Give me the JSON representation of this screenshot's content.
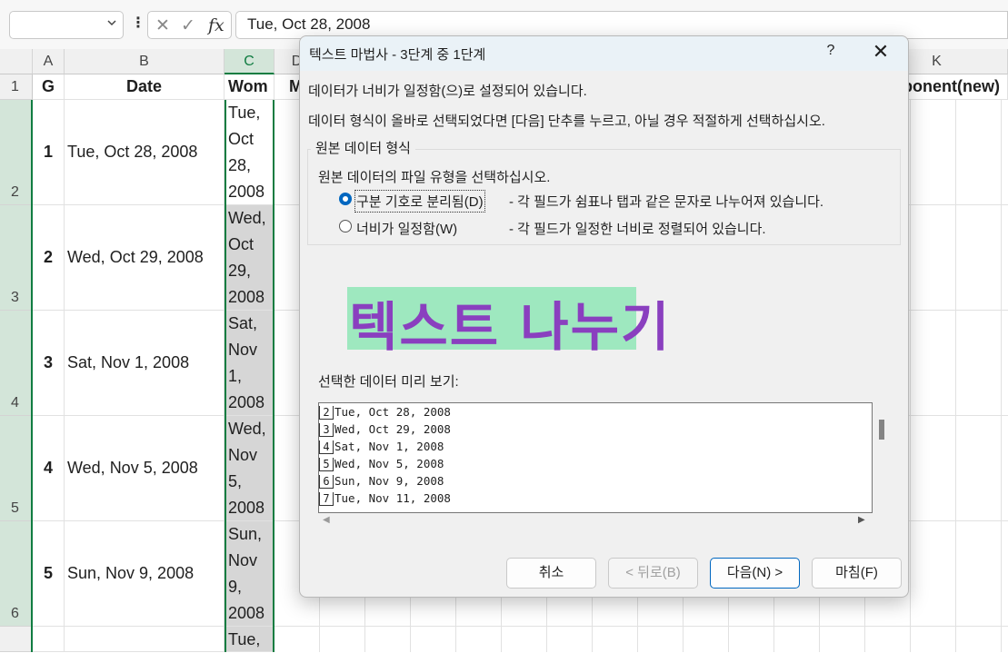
{
  "formula_bar": {
    "namebox_value": "",
    "fx": "fx",
    "cancel_glyph": "✕",
    "enter_glyph": "✓",
    "content": "Tue, Oct 28, 2008"
  },
  "columns": [
    "A",
    "B",
    "C",
    "D",
    "K"
  ],
  "rows": [
    "1",
    "2",
    "3",
    "4",
    "5",
    "6"
  ],
  "headers": {
    "a": "G",
    "b": "Date",
    "c": "Wom",
    "d": "M",
    "k": "ponent(new)"
  },
  "data_rows": [
    {
      "g": "1",
      "date": "Tue, Oct 28, 2008",
      "wom": "Tue,\nOct\n28,\n2008"
    },
    {
      "g": "2",
      "date": "Wed, Oct 29, 2008",
      "wom": "Wed,\nOct\n29,\n2008"
    },
    {
      "g": "3",
      "date": "Sat, Nov 1, 2008",
      "wom": "Sat,\nNov\n1,\n2008"
    },
    {
      "g": "4",
      "date": "Wed, Nov 5, 2008",
      "wom": "Wed,\nNov\n5,\n2008"
    },
    {
      "g": "5",
      "date": "Sun, Nov 9, 2008",
      "wom": "Sun,\nNov\n9,\n2008"
    }
  ],
  "wom_partial": "Tue,",
  "dialog": {
    "title": "텍스트 마법사 - 3단계 중 1단계",
    "help": "?",
    "close": "✕",
    "line1": "데이터가 너비가 일정함(으)로 설정되어 있습니다.",
    "line2": "데이터 형식이 올바로 선택되었다면 [다음] 단추를 누르고, 아닐 경우 적절하게 선택하십시오.",
    "group_label": "원본 데이터 형식",
    "group_prompt": "원본 데이터의 파일 유형을 선택하십시오.",
    "opt_delimited": "구분 기호로 분리됨(D)",
    "opt_delimited_desc": "- 각 필드가 쉼표나 탭과 같은 문자로 나누어져 있습니다.",
    "opt_fixed": "너비가 일정함(W)",
    "opt_fixed_desc": "- 각 필드가 일정한 너비로 정렬되어 있습니다.",
    "banner": "텍스트 나누기",
    "preview_label": "선택한 데이터 미리 보기:",
    "preview_rows": [
      {
        "num": "2",
        "text": "Tue, Oct 28, 2008"
      },
      {
        "num": "3",
        "text": "Wed, Oct 29, 2008"
      },
      {
        "num": "4",
        "text": "Sat, Nov 1, 2008"
      },
      {
        "num": "5",
        "text": "Wed, Nov 5, 2008"
      },
      {
        "num": "6",
        "text": "Sun, Nov 9, 2008"
      },
      {
        "num": "7",
        "text": "Tue, Nov 11, 2008"
      }
    ],
    "btn_cancel": "취소",
    "btn_back": "< 뒤로(B)",
    "btn_next": "다음(N) >",
    "btn_finish": "마침(F)"
  },
  "colors": {
    "accent": "#107c41",
    "dialog_accent": "#0067c0",
    "banner_bg": "#9ee8bf",
    "banner_text": "#8a3fbf"
  }
}
